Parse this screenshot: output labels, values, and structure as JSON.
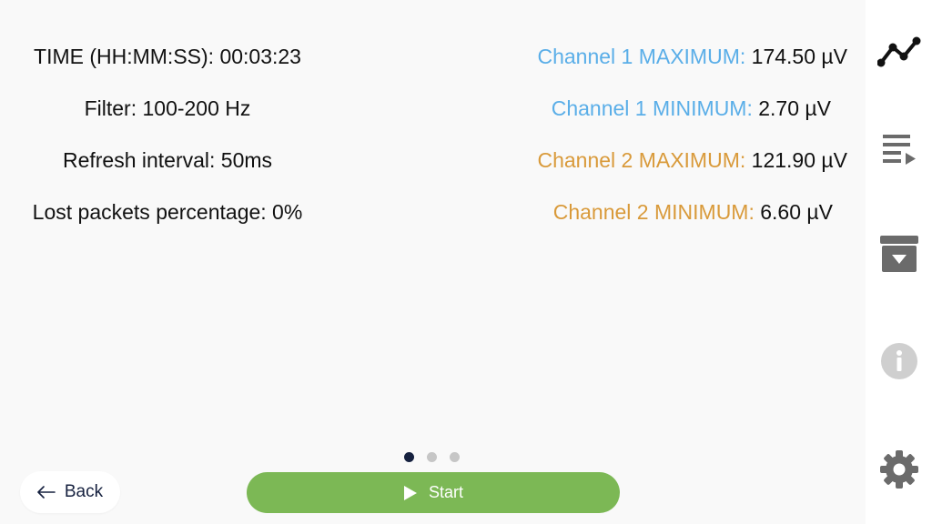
{
  "stats": {
    "time": "TIME (HH:MM:SS): 00:03:23",
    "filter": "Filter: 100-200 Hz",
    "refresh": "Refresh interval: 50ms",
    "lost_packets": "Lost packets percentage: 0%"
  },
  "channels": [
    {
      "label": "Channel 1 MAXIMUM:",
      "value": "174.50 µV",
      "color": "#5aaee8"
    },
    {
      "label": "Channel 1 MINIMUM:",
      "value": "2.70 µV",
      "color": "#5aaee8"
    },
    {
      "label": "Channel 2 MAXIMUM:",
      "value": "121.90 µV",
      "color": "#d99a3a"
    },
    {
      "label": "Channel 2 MINIMUM:",
      "value": "6.60 µV",
      "color": "#d99a3a"
    }
  ],
  "pagination": {
    "total": 3,
    "active": 1
  },
  "buttons": {
    "back_label": "Back",
    "start_label": "Start",
    "start_color": "#7cb855"
  },
  "sidebar": {
    "items": [
      {
        "icon": "chart-line-icon",
        "state": "active"
      },
      {
        "icon": "playlist-play-icon",
        "state": "normal"
      },
      {
        "icon": "archive-download-icon",
        "state": "normal"
      },
      {
        "icon": "info-icon",
        "state": "disabled"
      },
      {
        "icon": "gear-icon",
        "state": "normal"
      }
    ]
  }
}
